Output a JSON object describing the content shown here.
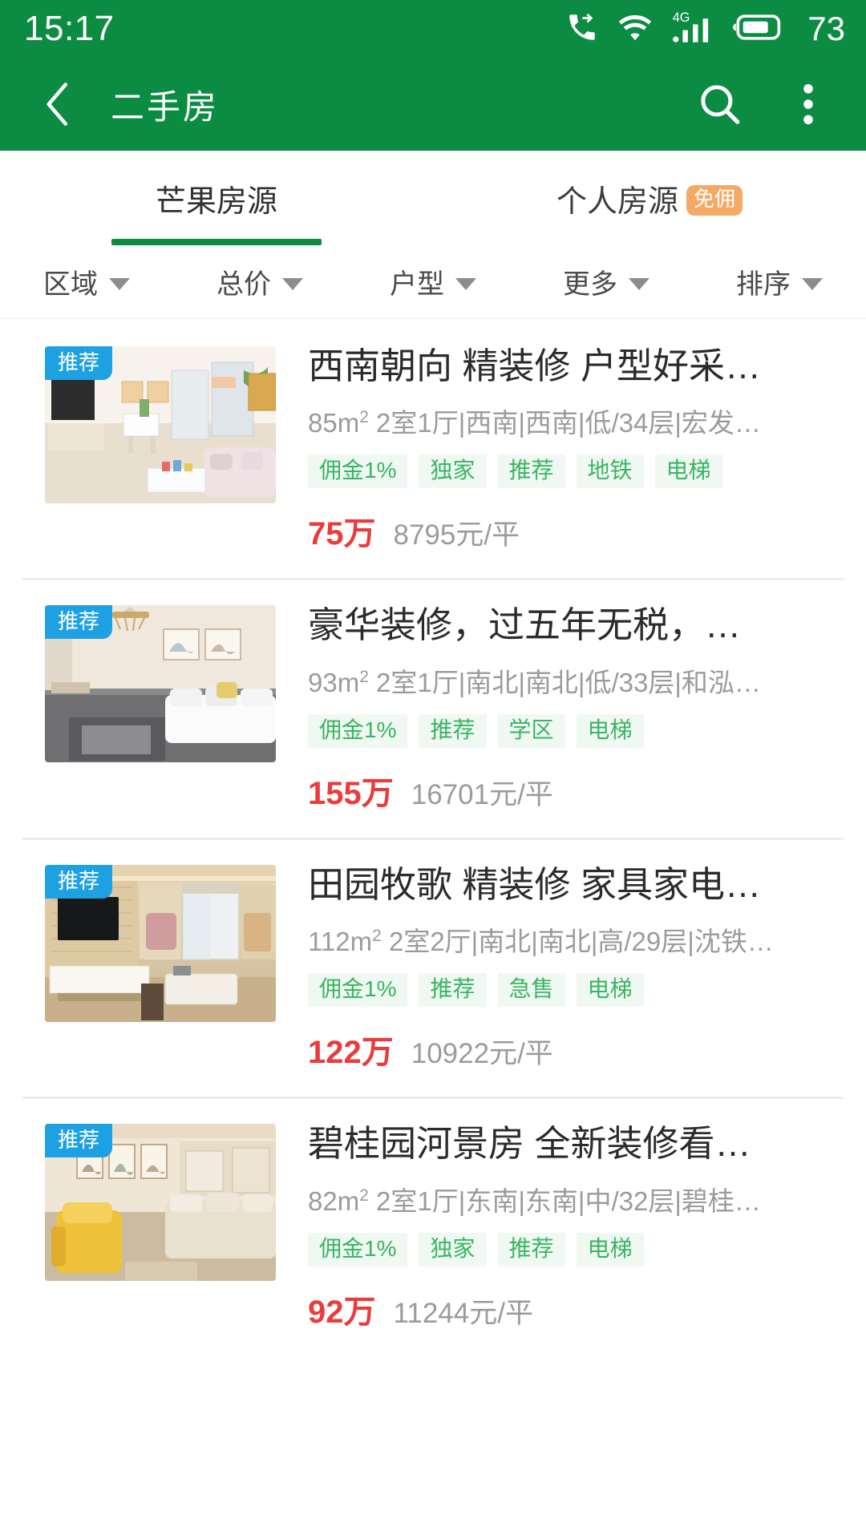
{
  "status_bar": {
    "time": "15:17",
    "battery_percent": "73",
    "network_type": "4G",
    "icons": [
      "call-forward-icon",
      "wifi-icon",
      "cellular-signal-icon",
      "battery-icon"
    ]
  },
  "app_bar": {
    "back_icon": "chevron-left-icon",
    "title": "二手房",
    "search_icon": "search-icon",
    "overflow_icon": "more-vertical-icon"
  },
  "tabs": [
    {
      "label": "芒果房源",
      "active": true,
      "badge": ""
    },
    {
      "label": "个人房源",
      "active": false,
      "badge": "免佣"
    }
  ],
  "filters": [
    {
      "label": "区域",
      "icon": "chevron-down-icon"
    },
    {
      "label": "总价",
      "icon": "chevron-down-icon"
    },
    {
      "label": "户型",
      "icon": "chevron-down-icon"
    },
    {
      "label": "更多",
      "icon": "chevron-down-icon"
    },
    {
      "label": "排序",
      "icon": "chevron-down-icon"
    }
  ],
  "listings": [
    {
      "badge": "推荐",
      "title": "西南朝向 精装修 户型好采…",
      "area": "85m",
      "area_sup": "2",
      "detail": " 2室1厅|西南|西南|低/34层|宏发…",
      "tags": [
        "佣金1%",
        "独家",
        "推荐",
        "地铁",
        "电梯"
      ],
      "price_total": "75万",
      "price_unit": "8795元/平"
    },
    {
      "badge": "推荐",
      "title": "豪华装修，过五年无税，…",
      "area": "93m",
      "area_sup": "2",
      "detail": " 2室1厅|南北|南北|低/33层|和泓…",
      "tags": [
        "佣金1%",
        "推荐",
        "学区",
        "电梯"
      ],
      "price_total": "155万",
      "price_unit": "16701元/平"
    },
    {
      "badge": "推荐",
      "title": "田园牧歌 精装修 家具家电…",
      "area": "112m",
      "area_sup": "2",
      "detail": " 2室2厅|南北|南北|高/29层|沈铁…",
      "tags": [
        "佣金1%",
        "推荐",
        "急售",
        "电梯"
      ],
      "price_total": "122万",
      "price_unit": "10922元/平"
    },
    {
      "badge": "推荐",
      "title": "碧桂园河景房 全新装修看…",
      "area": "82m",
      "area_sup": "2",
      "detail": " 2室1厅|东南|东南|中/32层|碧桂…",
      "tags": [
        "佣金1%",
        "独家",
        "推荐",
        "电梯"
      ],
      "price_total": "92万",
      "price_unit": "11244元/平"
    }
  ],
  "colors": {
    "brand_green": "#0c8c42",
    "price_red": "#ea3c3c",
    "tag_green": "#3ab563",
    "rec_badge_blue": "#1ea1e2",
    "free_badge_orange": "#f5a964"
  }
}
